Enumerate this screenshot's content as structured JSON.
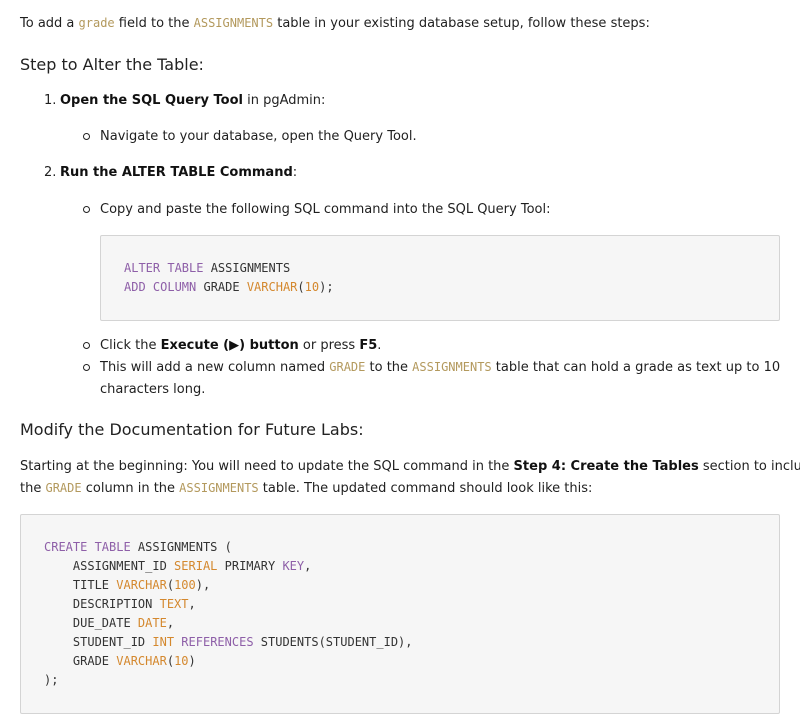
{
  "intro": {
    "t1": "To add a ",
    "c1": "grade",
    "t2": " field to the ",
    "c2": "ASSIGNMENTS",
    "t3": " table in your existing database setup, follow these steps:"
  },
  "section1_title": "Step to Alter the Table:",
  "step1": {
    "num": "1.",
    "bold": "Open the SQL Query Tool",
    "rest": " in pgAdmin:",
    "bullet": "Navigate to your database, open the Query Tool."
  },
  "step2": {
    "num": "2.",
    "bold": "Run the ALTER TABLE Command",
    "rest": ":",
    "bullet1": "Copy and paste the following SQL command into the SQL Query Tool:",
    "code_line1": {
      "kw": "ALTER TABLE",
      "rest": " ASSIGNMENTS"
    },
    "code_line2": {
      "kw": "ADD COLUMN",
      "mid": " GRADE ",
      "ty": "VARCHAR",
      "p1": "(",
      "num": "10",
      "p2": ");"
    },
    "bullet2": {
      "t1": "Click the ",
      "b1": "Execute (▶) button",
      "t2": " or press ",
      "b2": "F5",
      "t3": "."
    },
    "bullet3": {
      "t1": "This will add a new column named ",
      "c1": "GRADE",
      "t2": " to the ",
      "c2": "ASSIGNMENTS",
      "t3": " table that can hold a grade as text up to 10",
      "t4": "characters long."
    }
  },
  "section2_title": "Modify the Documentation for Future Labs:",
  "para2": {
    "t1": "Starting at the beginning: You will need to update the SQL command in the ",
    "b1": "Step 4: Create the Tables",
    "t2": " section to include",
    "t3": "the ",
    "c1": "GRADE",
    "t4": " column in the ",
    "c2": "ASSIGNMENTS",
    "t5": " table. The updated command should look like this:"
  },
  "create_code": {
    "l1": {
      "kw": "CREATE TABLE",
      "rest": " ASSIGNMENTS ("
    },
    "l2": {
      "a": "    ASSIGNMENT_ID ",
      "ty": "SERIAL",
      "b": " PRIMARY ",
      "kw": "KEY",
      "c": ","
    },
    "l3": {
      "a": "    TITLE ",
      "ty": "VARCHAR",
      "b": "(",
      "num": "100",
      "c": "),"
    },
    "l4": {
      "a": "    DESCRIPTION ",
      "ty": "TEXT",
      "c": ","
    },
    "l5": {
      "a": "    DUE_DATE ",
      "ty": "DATE",
      "c": ","
    },
    "l6": {
      "a": "    STUDENT_ID ",
      "ty": "INT",
      "sp": " ",
      "kw": "REFERENCES",
      "c": " STUDENTS(STUDENT_ID),"
    },
    "l7": {
      "a": "    GRADE ",
      "ty": "VARCHAR",
      "b": "(",
      "num": "10",
      "c": ")"
    },
    "l8": ");"
  }
}
